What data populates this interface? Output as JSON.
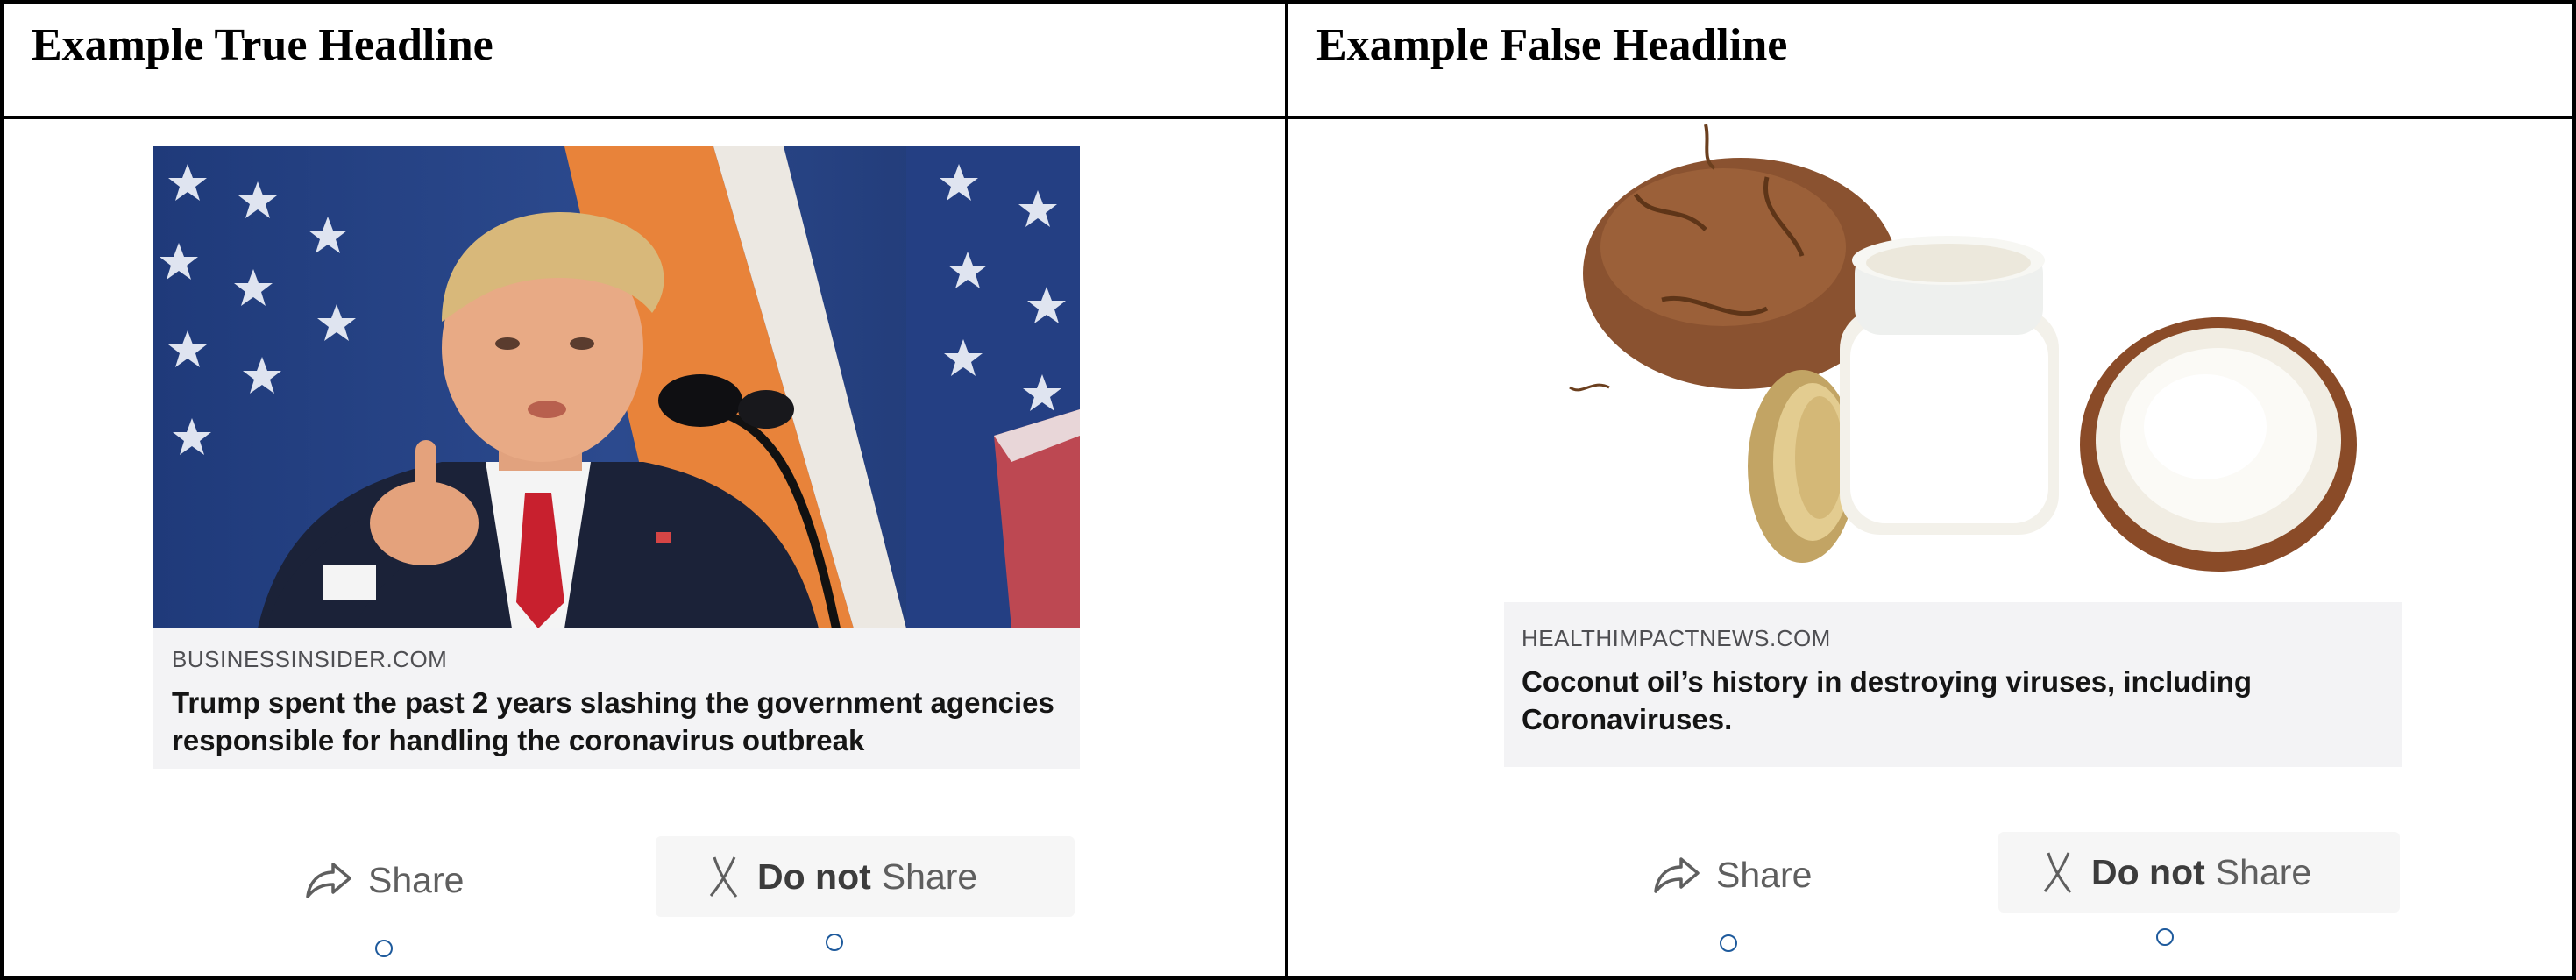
{
  "left_panel": {
    "header": "Example True Headline",
    "card": {
      "domain": "BUSINESSINSIDER.COM",
      "title": "Trump spent the past 2 years slashing the government agencies responsible for handling the coronavirus outbreak"
    },
    "share_label": "Share",
    "do_not_label": "Do not",
    "do_not_share_label": "Share"
  },
  "right_panel": {
    "header": "Example False Headline",
    "card": {
      "domain": "HEALTHIMPACTNEWS.COM",
      "title": "Coconut oil’s history in destroying viruses, including Coronaviruses."
    },
    "share_label": "Share",
    "do_not_label": "Do not",
    "do_not_share_label": "Share"
  },
  "icons": {
    "share": "share-arrow-icon",
    "do_not_share": "x-mark-icon"
  },
  "colors": {
    "radio_border": "#1e5a9c",
    "card_meta_bg": "#f3f3f5"
  }
}
